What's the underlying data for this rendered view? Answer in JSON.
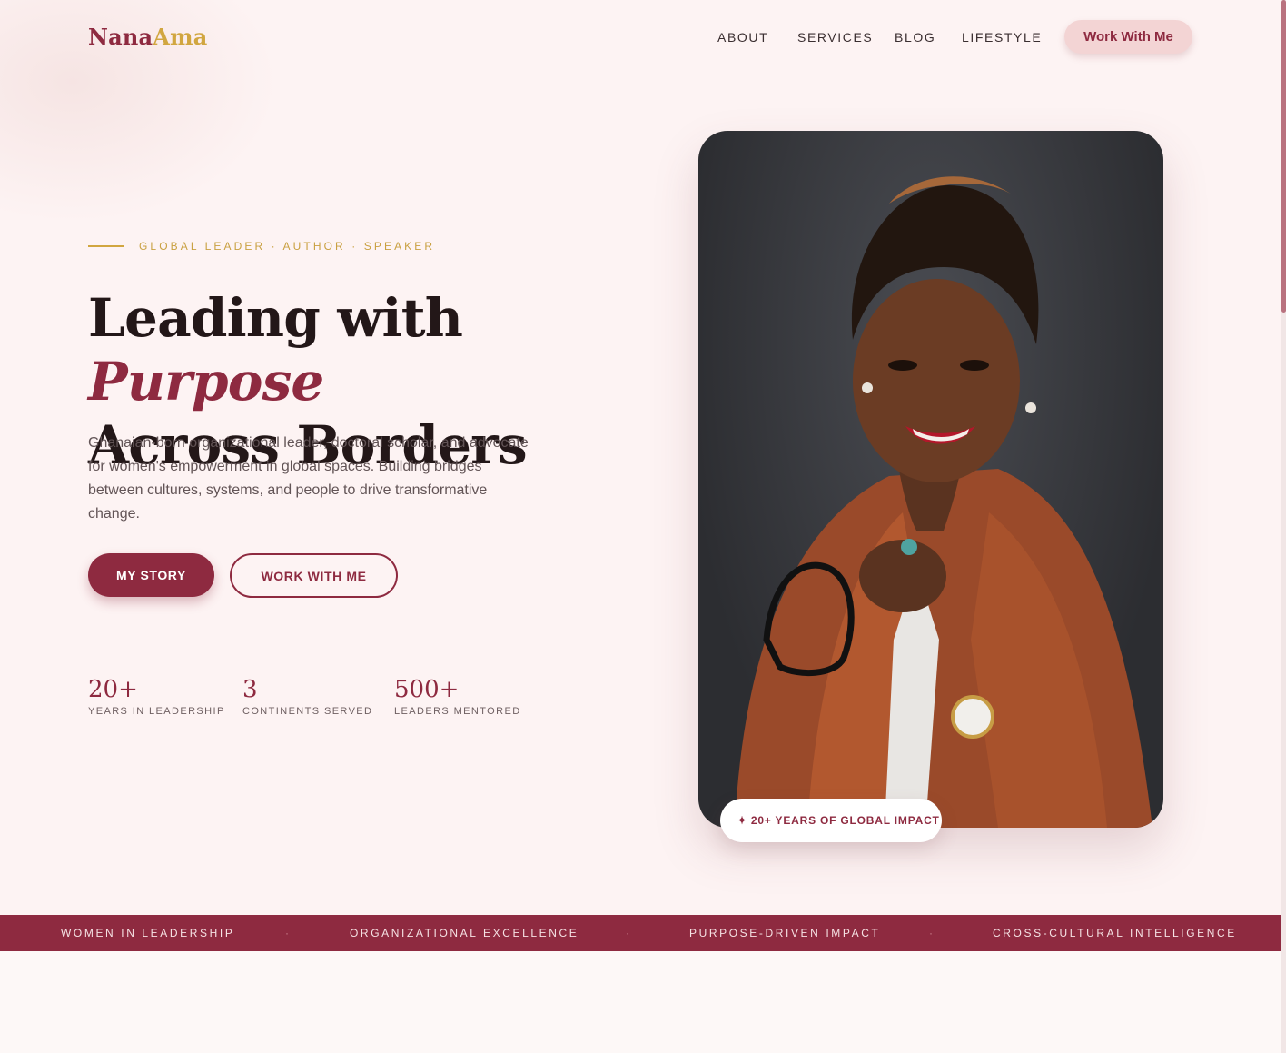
{
  "brand": {
    "first": "Nana",
    "second": "Ama"
  },
  "nav": {
    "items": [
      "ABOUT",
      "SERVICES",
      "BLOG",
      "LIFESTYLE"
    ],
    "cta": "Work With Me"
  },
  "hero": {
    "eyebrow": "GLOBAL LEADER · AUTHOR · SPEAKER",
    "headline_part1": "Leading with",
    "headline_emphasis": "Purpose",
    "headline_part2": "Across Borders",
    "lede": "Ghanaian-born organizational leader, doctoral scholar, and advocate for women's empowerment in global spaces. Building bridges between cultures, systems, and people to drive transformative change.",
    "primary_button": "MY STORY",
    "secondary_button": "WORK WITH ME"
  },
  "stats": [
    {
      "value": "20+",
      "label": "YEARS IN LEADERSHIP"
    },
    {
      "value": "3",
      "label": "CONTINENTS SERVED"
    },
    {
      "value": "500+",
      "label": "LEADERS MENTORED"
    }
  ],
  "portrait_badge": {
    "icon": "sparkle-icon",
    "text": "20+ YEARS OF GLOBAL IMPACT"
  },
  "marquee": [
    "WOMEN IN LEADERSHIP",
    "ORGANIZATIONAL EXCELLENCE",
    "PURPOSE-DRIVEN IMPACT",
    "CROSS-CULTURAL INTELLIGENCE"
  ],
  "colors": {
    "accent": "#8e2a40",
    "gold": "#d1a640",
    "background": "#fdf3f3"
  }
}
